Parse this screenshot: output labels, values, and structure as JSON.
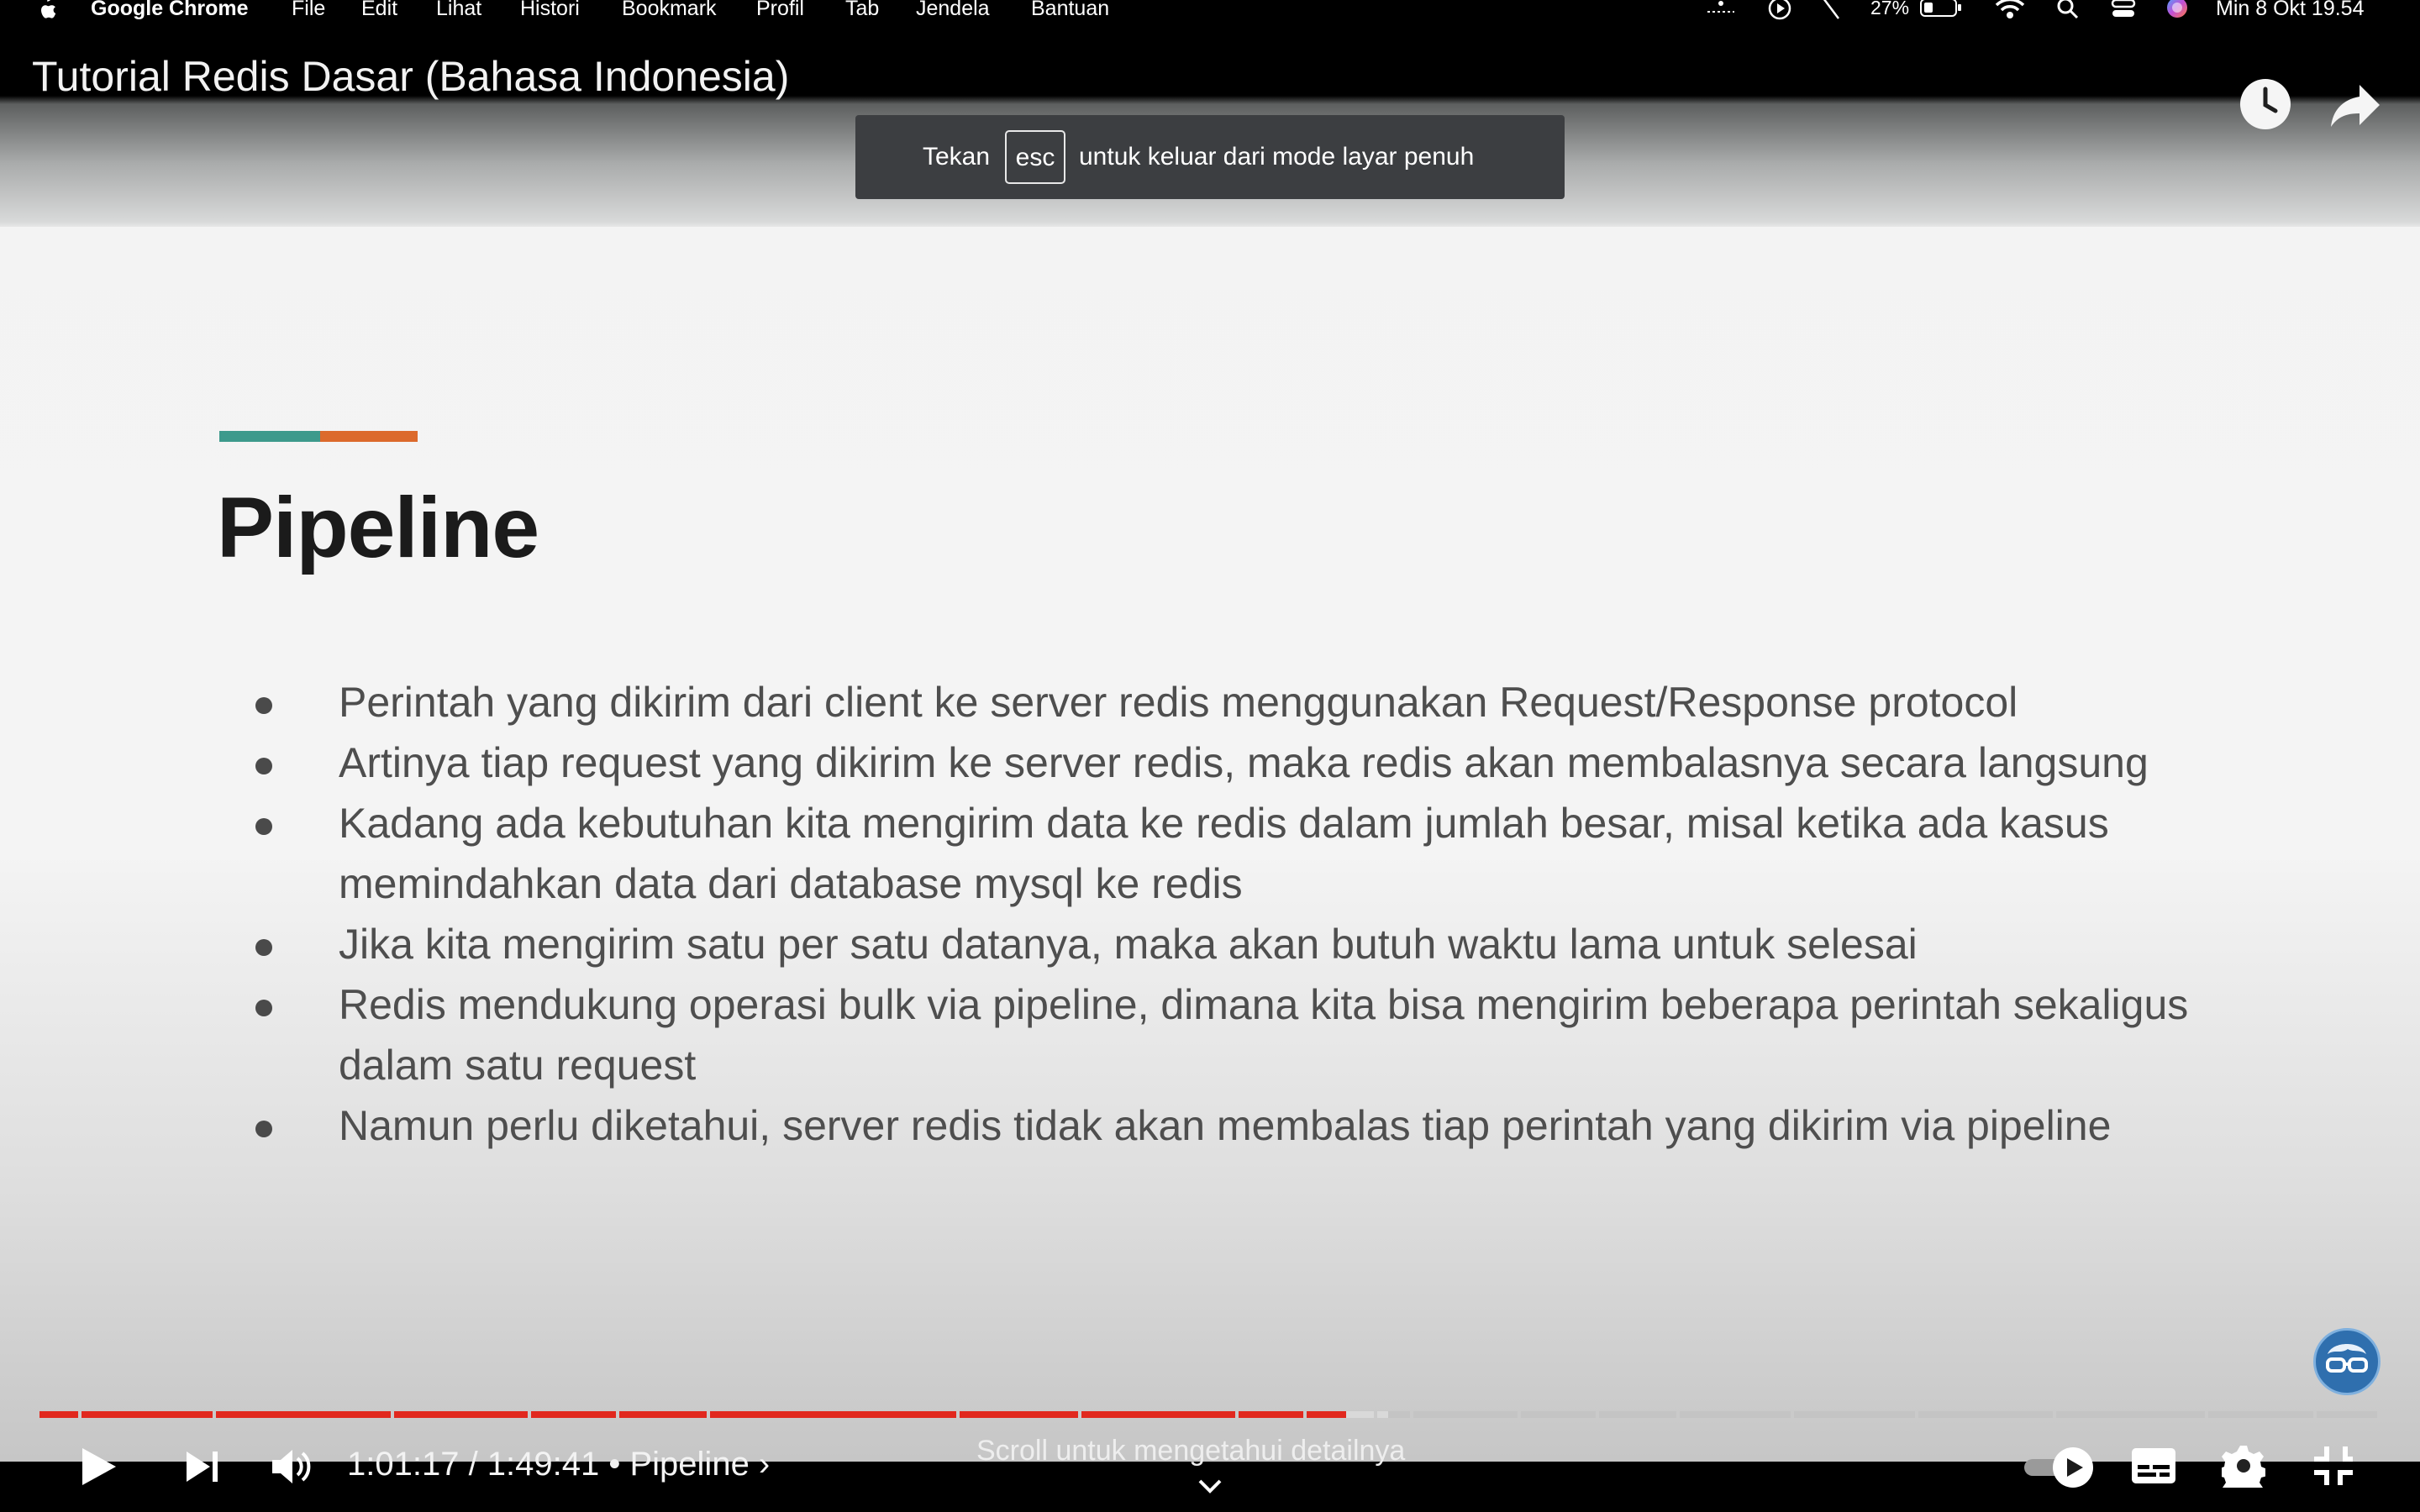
{
  "menubar": {
    "app_name": "Google Chrome",
    "items": [
      "File",
      "Edit",
      "Lihat",
      "Histori",
      "Bookmark",
      "Profil",
      "Tab",
      "Jendela",
      "Bantuan"
    ],
    "battery": "27%",
    "datetime": "Min 8 Okt  19.54"
  },
  "player": {
    "video_title": "Tutorial Redis Dasar (Bahasa Indonesia)",
    "toast": {
      "prefix": "Tekan",
      "key": "esc",
      "suffix": "untuk keluar dari mode layar penuh"
    },
    "time_display": "1:01:17 / 1:49:41 • Pipeline ›",
    "current_time": "1:01:17",
    "duration": "1:49:41",
    "chapter": "Pipeline",
    "progress_fraction": 0.558,
    "scroll_hint": "Scroll untuk mengetahui detailnya",
    "colors": {
      "played": "#e1281e",
      "background": "#000000"
    }
  },
  "slide": {
    "title": "Pipeline",
    "bullets": [
      "Perintah yang dikirim dari client ke server redis menggunakan Request/Response protocol",
      "Artinya tiap request yang dikirim ke server redis, maka redis akan membalasnya secara langsung",
      "Kadang ada kebutuhan kita mengirim data ke redis dalam jumlah besar, misal ketika ada kasus memindahkan data dari database mysql ke redis",
      "Jika kita mengirim satu per satu datanya, maka akan butuh waktu lama untuk selesai",
      "Redis mendukung operasi bulk via pipeline, dimana kita bisa mengirim beberapa perintah sekaligus dalam satu request",
      "Namun perlu diketahui, server redis tidak akan membalas tiap perintah yang dikirim via pipeline"
    ],
    "accent_colors": [
      "#3d9a8c",
      "#dc6a2c"
    ]
  }
}
